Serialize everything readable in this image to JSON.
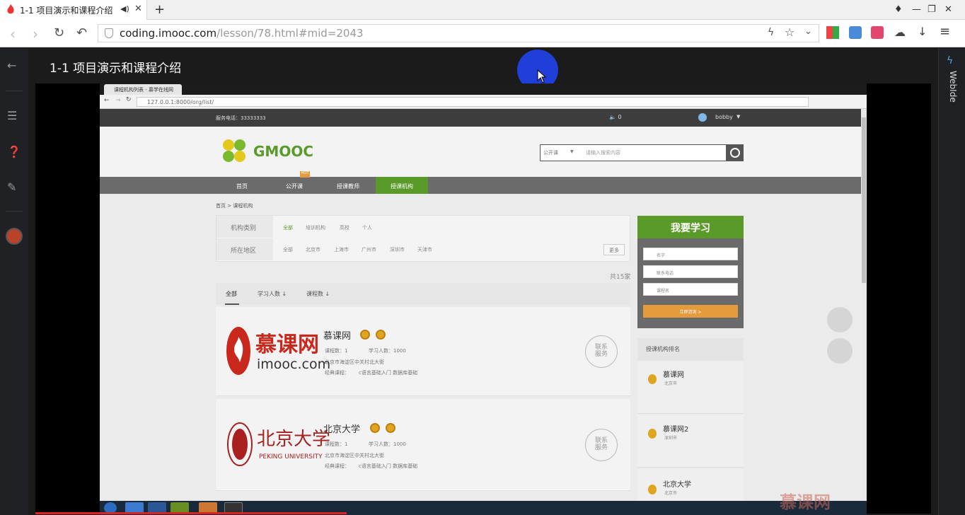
{
  "browser": {
    "tab_title": "1-1 项目演示和课程介绍",
    "url_host": "coding.imooc.com",
    "url_path": "/lesson/78.html#mid=2043"
  },
  "sidebar_right": {
    "label": "WebIde"
  },
  "lesson": {
    "title": "1-1 项目演示和课程介绍"
  },
  "inner_browser": {
    "tab_title": "课程机构列表 - 慕学在线网",
    "url": "127.0.0.1:8000/org/list/"
  },
  "site": {
    "phone": "服务电话：33333333",
    "messages": "0",
    "username": "bobby",
    "logo": "GMOOC",
    "search_category": "公开课",
    "search_placeholder": "请输入搜索内容",
    "nav": [
      "首页",
      "公开课",
      "授课教师",
      "授课机构"
    ],
    "nav_hot": "HOT",
    "breadcrumb": "首页 > 课程机构",
    "filter": {
      "category_label": "机构类别",
      "category_options": [
        "全部",
        "培训机构",
        "高校",
        "个人"
      ],
      "region_label": "所在地区",
      "region_options": [
        "全部",
        "北京市",
        "上海市",
        "广州市",
        "深圳市",
        "天津市"
      ],
      "more": "更多"
    },
    "total": "共15家",
    "sort": [
      "全部",
      "学习人数 ↓",
      "课程数 ↓"
    ],
    "orgs": [
      {
        "name": "慕课网",
        "courses": "课程数：1",
        "students": "学习人数：1000",
        "address": "北京市海淀区中关村北大街",
        "classic": "经典课程：",
        "classic_courses": "c语言基础入门   数据库基础",
        "logo_text_cn": "慕课网",
        "logo_text_en": "imooc.com",
        "contact": "联系\n服务"
      },
      {
        "name": "北京大学",
        "courses": "课程数：1",
        "students": "学习人数：1000",
        "address": "北京市海淀区中关村北大街",
        "classic": "经典课程：",
        "classic_courses": "c语言基础入门   数据库基础",
        "logo_text_cn": "北京大学",
        "logo_text_en": "PEKING UNIVERSITY",
        "contact": "联系\n服务"
      }
    ],
    "learn_panel": {
      "title": "我要学习",
      "name_ph": "名字",
      "phone_ph": "联系电话",
      "course_ph": "课程名",
      "submit": "立即咨询 >"
    },
    "rank": {
      "title": "授课机构排名",
      "items": [
        {
          "name": "慕课网",
          "city": "北京市"
        },
        {
          "name": "慕课网2",
          "city": "深圳市"
        },
        {
          "name": "北京大学",
          "city": "北京市"
        }
      ]
    }
  },
  "colors": {
    "brand_green": "#5a9a28",
    "accent_orange": "#e49b3c",
    "progress_red": "#dd2222"
  }
}
